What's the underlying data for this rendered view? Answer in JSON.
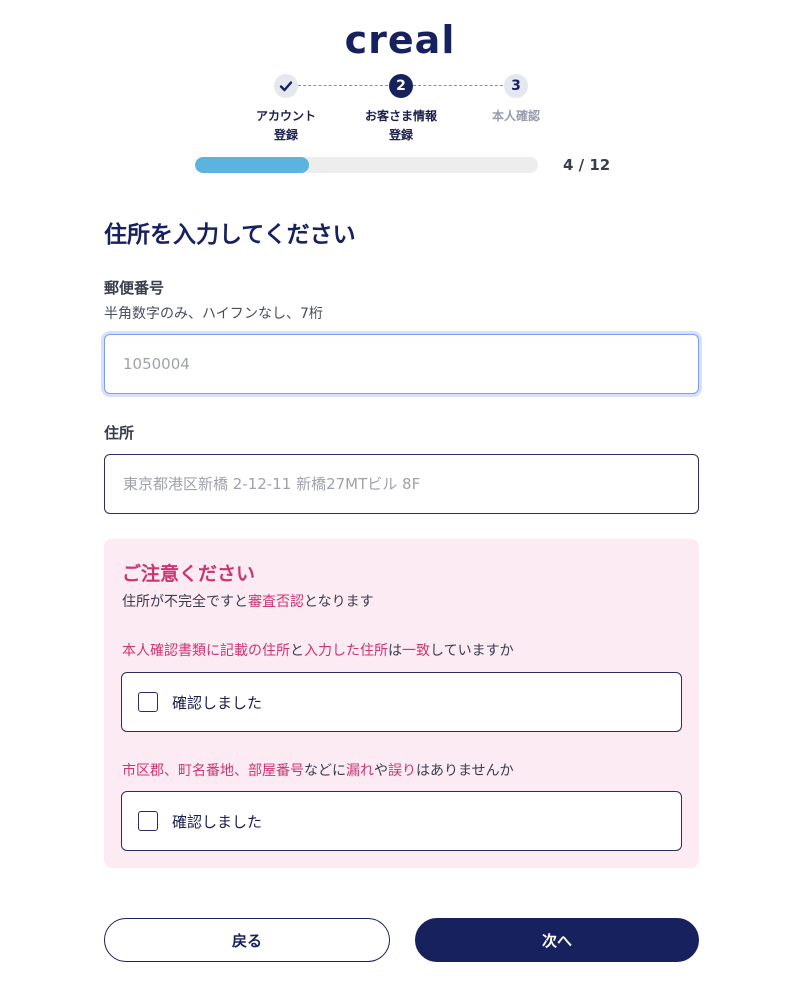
{
  "header": {
    "logo": "creal"
  },
  "stepper": {
    "steps": [
      {
        "number": "✓",
        "label_line1": "アカウント",
        "label_line2": "登録",
        "state": "done"
      },
      {
        "number": "2",
        "label_line1": "お客さま情報",
        "label_line2": "登録",
        "state": "active"
      },
      {
        "number": "3",
        "label_line1": "本人確認",
        "label_line2": "",
        "state": "todo"
      }
    ]
  },
  "progress": {
    "current": 4,
    "total": 12,
    "text": "4 / 12",
    "fraction": 0.333
  },
  "page": {
    "title": "住所を入力してください"
  },
  "postal": {
    "label": "郵便番号",
    "hint": "半角数字のみ、ハイフンなし、7桁",
    "placeholder": "1050004",
    "value": ""
  },
  "address": {
    "label": "住所",
    "placeholder": "東京都港区新橋 2-12-11 新橋27MTビル 8F",
    "value": ""
  },
  "notice": {
    "title": "ご注意ください",
    "subtitle_parts": [
      "住所が不完全ですと",
      "審査否認",
      "となります"
    ],
    "question1_parts": [
      "本人確認書類に記載の住所",
      "と",
      "入力した住所",
      "は",
      "一致",
      "していますか"
    ],
    "question2_parts": [
      "市区郡、町名番地、部屋番号",
      "などに",
      "漏れ",
      "や",
      "誤り",
      "はありませんか"
    ],
    "confirm1": {
      "label": "確認しました",
      "checked": false
    },
    "confirm2": {
      "label": "確認しました",
      "checked": false
    }
  },
  "actions": {
    "back_label": "戻る",
    "next_label": "次へ"
  },
  "colors": {
    "navy": "#17215e",
    "pink": "#c83773",
    "progress": "#5db3e0",
    "notice_bg": "#fcebf2"
  }
}
